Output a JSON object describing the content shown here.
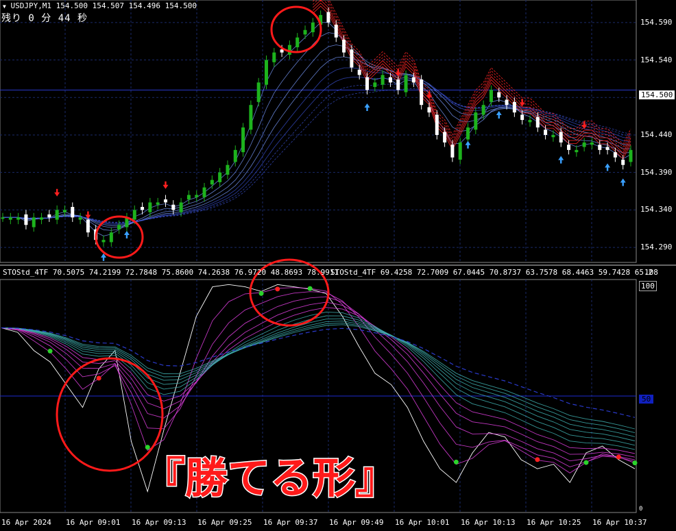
{
  "main_window": {
    "symbol_line": "USDJPY,M1  154.500 154.507 154.496 154.500",
    "timer_text": "残り 0 分 44 秒",
    "price_ticks": [
      "154.590",
      "154.540",
      "154.490",
      "154.440",
      "154.390",
      "154.340",
      "154.290"
    ],
    "current_price_label": "154.500"
  },
  "sub_window": {
    "indicator_line_1": "STOStd_4TF 70.5075 74.2199 72.7848 75.8600 74.2638 76.9720 48.8693 78.9911",
    "indicator_line_2": "STOStd_4TF 69.4258 72.7009 67.0445 70.8737 63.7578 68.4463 59.7428 65.2",
    "scale_max_top": "108",
    "scale_100": "100",
    "scale_50": "50",
    "scale_0": "0"
  },
  "time_axis": [
    "16 Apr 2024",
    "16 Apr 09:01",
    "16 Apr 09:13",
    "16 Apr 09:25",
    "16 Apr 09:37",
    "16 Apr 09:49",
    "16 Apr 10:01",
    "16 Apr 10:13",
    "16 Apr 10:25",
    "16 Apr 10:37"
  ],
  "overlay_caption": "『勝てる形』",
  "colors": {
    "background": "#000000",
    "bull_candle": "#1db31d",
    "bear_candle": "#ffffff",
    "sell_arrow": "#ff2020",
    "buy_arrow": "#3aa0ff",
    "ribbon_red": "#e02020",
    "ribbon_blue": "#3a6cff",
    "stoch_magenta": "#e040e0",
    "stoch_teal": "#3fb0b0",
    "highlight_circle": "#ff1a1a",
    "grid": "#1a2a6a"
  },
  "chart_data": {
    "type": "candlestick",
    "symbol": "USDJPY",
    "timeframe": "M1",
    "ylim": [
      154.27,
      154.62
    ],
    "close_path": [
      154.33,
      154.33,
      154.33,
      154.32,
      154.33,
      154.33,
      154.33,
      154.34,
      154.34,
      154.33,
      154.33,
      154.31,
      154.3,
      154.3,
      154.31,
      154.32,
      154.33,
      154.34,
      154.34,
      154.35,
      154.35,
      154.35,
      154.34,
      154.35,
      154.36,
      154.36,
      154.37,
      154.38,
      154.39,
      154.4,
      154.42,
      154.45,
      154.48,
      154.51,
      154.54,
      154.55,
      154.55,
      154.56,
      154.57,
      154.58,
      154.59,
      154.6,
      154.59,
      154.57,
      154.55,
      154.53,
      154.52,
      154.5,
      154.51,
      154.52,
      154.51,
      154.5,
      154.52,
      154.51,
      154.48,
      154.47,
      154.44,
      154.43,
      154.41,
      154.43,
      154.45,
      154.47,
      154.48,
      154.5,
      154.49,
      154.48,
      154.47,
      154.46,
      154.46,
      154.45,
      154.44,
      154.44,
      154.43,
      154.42,
      154.42,
      154.43,
      154.43,
      154.42,
      154.42,
      154.41,
      154.4,
      154.42
    ]
  }
}
